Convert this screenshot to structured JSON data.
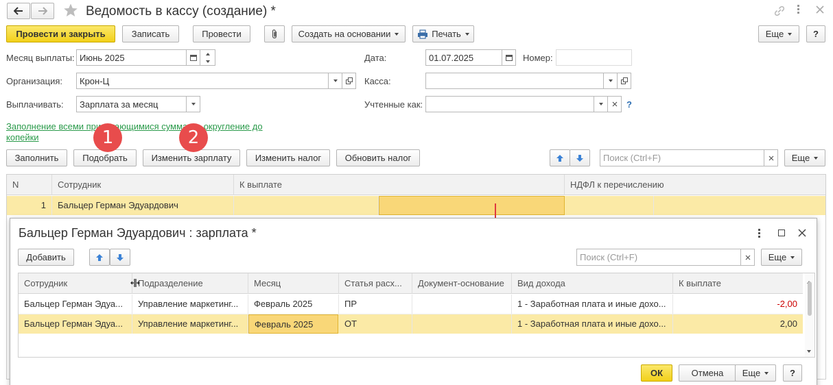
{
  "window": {
    "title": "Ведомость в кассу (создание) *"
  },
  "toolbar": {
    "post_close": "Провести и закрыть",
    "write": "Записать",
    "post": "Провести",
    "create_based": "Создать на основании",
    "print": "Печать",
    "more": "Еще",
    "help": "?"
  },
  "form": {
    "month_label": "Месяц выплаты:",
    "month_value": "Июнь 2025",
    "date_label": "Дата:",
    "date_value": "01.07.2025",
    "number_label": "Номер:",
    "number_value": "",
    "org_label": "Организация:",
    "org_value": "Крон-Ц",
    "cash_label": "Касса:",
    "cash_value": "",
    "pay_label": "Выплачивать:",
    "pay_value": "Зарплата за месяц",
    "accounted_label": "Учтенные как:",
    "accounted_value": "",
    "accounted_help": "?",
    "fill_link_line1": "Заполнение всеми причитающимися суммами, округление до",
    "fill_link_line2": "копейки"
  },
  "table_toolbar": {
    "fill": "Заполнить",
    "pick": "Подобрать",
    "change_salary": "Изменить зарплату",
    "change_tax": "Изменить налог",
    "update_tax": "Обновить налог",
    "search_placeholder": "Поиск (Ctrl+F)",
    "more": "Еще"
  },
  "main_table": {
    "columns": [
      "N",
      "Сотрудник",
      "К выплате",
      "НДФЛ к перечислению"
    ],
    "rows": [
      {
        "n": "1",
        "employee": "Бальцер Герман Эдуардович",
        "payout": "",
        "tax": ""
      }
    ]
  },
  "annotations": [
    "1",
    "2"
  ],
  "dialog": {
    "title": "Бальцер Герман Эдуардович : зарплата *",
    "add": "Добавить",
    "search_placeholder": "Поиск (Ctrl+F)",
    "more": "Еще",
    "columns": [
      "Сотрудник",
      "Подразделение",
      "Месяц",
      "Статья расх...",
      "Документ-основание",
      "Вид дохода",
      "К выплате"
    ],
    "rows": [
      {
        "employee": "Бальцер Герман Эдуа...",
        "department": "Управление маркетинг...",
        "month": "Февраль 2025",
        "item": "ПР",
        "doc": "",
        "income": "1 - Заработная плата и иные дохо...",
        "amount": "-2,00"
      },
      {
        "employee": "Бальцер Герман Эдуа...",
        "department": "Управление маркетинг...",
        "month": "Февраль 2025",
        "item": "ОТ",
        "doc": "",
        "income": "1 - Заработная плата и иные дохо...",
        "amount": "2,00"
      }
    ],
    "ok": "ОК",
    "cancel": "Отмена",
    "help": "?"
  },
  "colors": {
    "accent_yellow": "#f5d327",
    "selected_row": "#fbeaa6",
    "link_green": "#2a9a4a",
    "badge_red": "#e84c4c",
    "negative": "#cc0000"
  }
}
